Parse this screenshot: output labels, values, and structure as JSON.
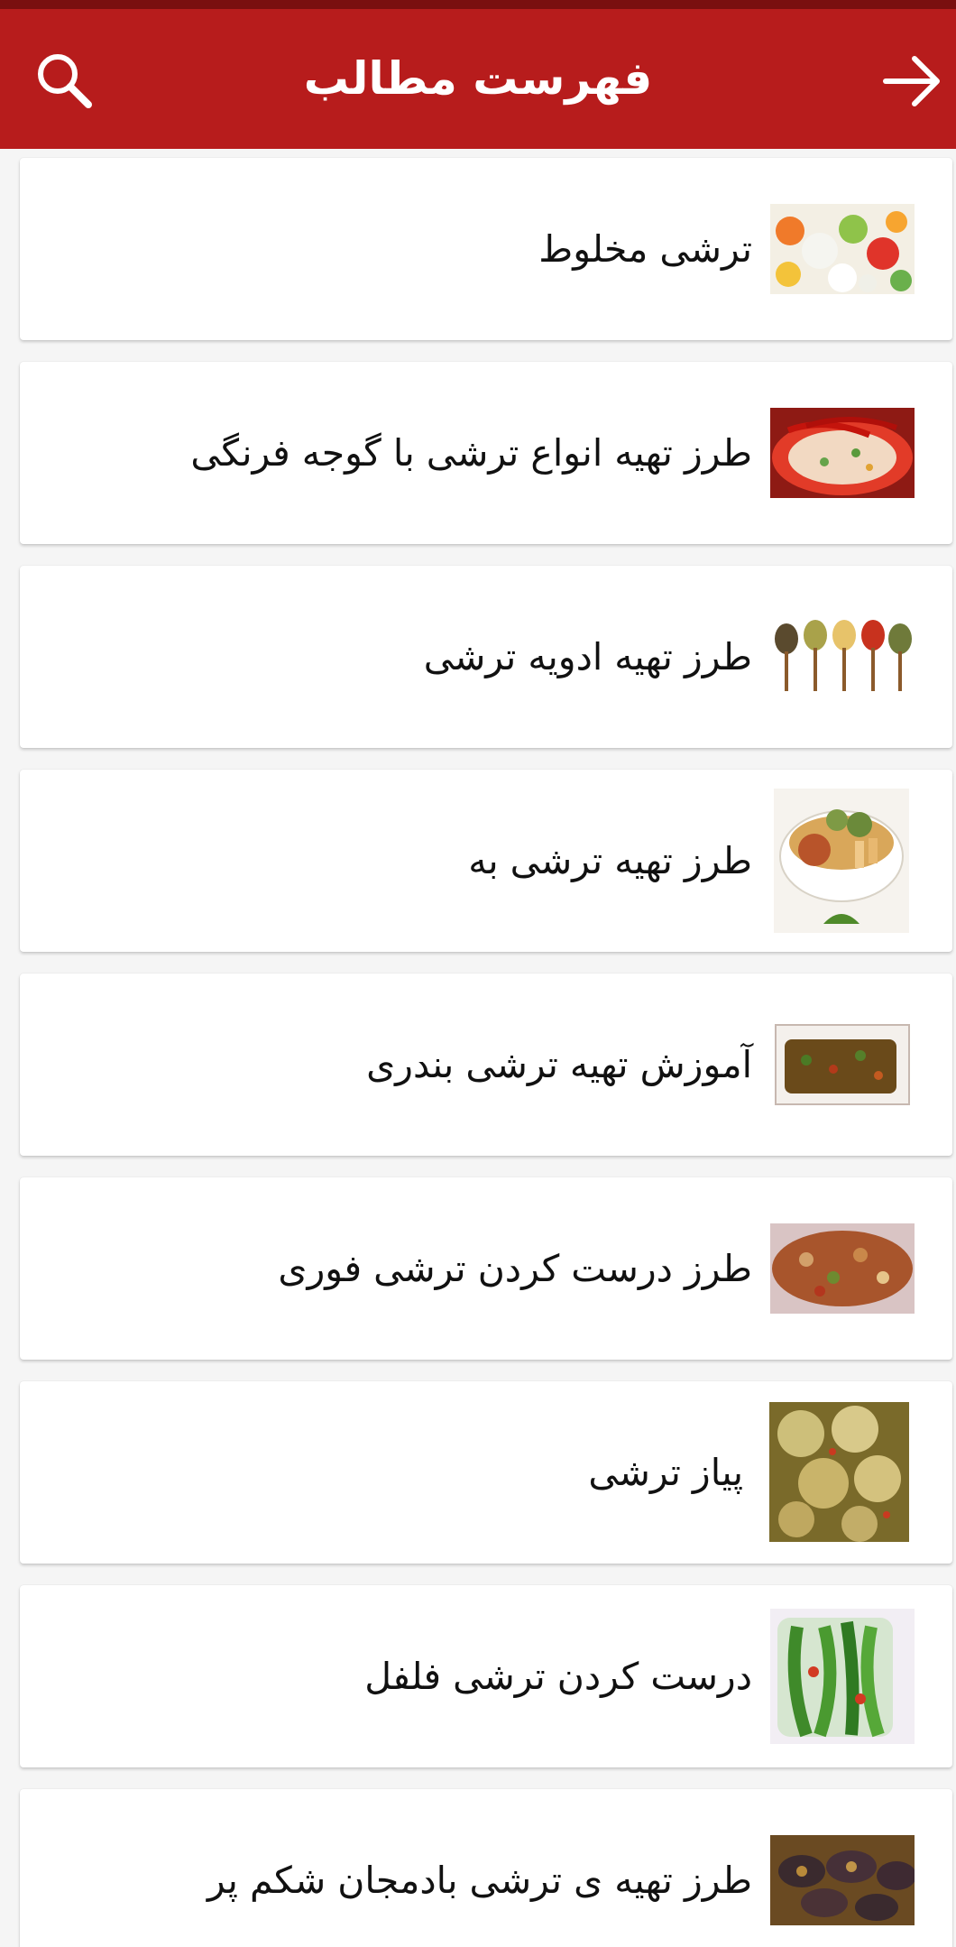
{
  "app_bar": {
    "title": "فهرست مطالب",
    "search_icon": "search-icon",
    "back_icon": "arrow-right-icon",
    "color": "#b71c1c"
  },
  "items": [
    {
      "label": "ترشی مخلوط",
      "image": "mixed-pickle-thumbnail"
    },
    {
      "label": "طرز تهیه انواع ترشی با گوجه فرنگی",
      "image": "tomato-pickle-thumbnail"
    },
    {
      "label": "طرز تهیه ادویه ترشی",
      "image": "spices-spoons-thumbnail"
    },
    {
      "label": "طرز تهیه ترشی به",
      "image": "quince-pickle-thumbnail"
    },
    {
      "label": "آموزش تهیه ترشی بندری",
      "image": "bandari-pickle-thumbnail"
    },
    {
      "label": "طرز درست کردن ترشی فوری",
      "image": "instant-pickle-thumbnail"
    },
    {
      "label": "پیاز ترشی",
      "image": "pickled-onion-thumbnail"
    },
    {
      "label": "درست کردن ترشی فلفل",
      "image": "pepper-pickle-thumbnail"
    },
    {
      "label": "طرز تهیه ی ترشی بادمجان شکم پر",
      "image": "stuffed-eggplant-pickle-thumbnail"
    }
  ]
}
